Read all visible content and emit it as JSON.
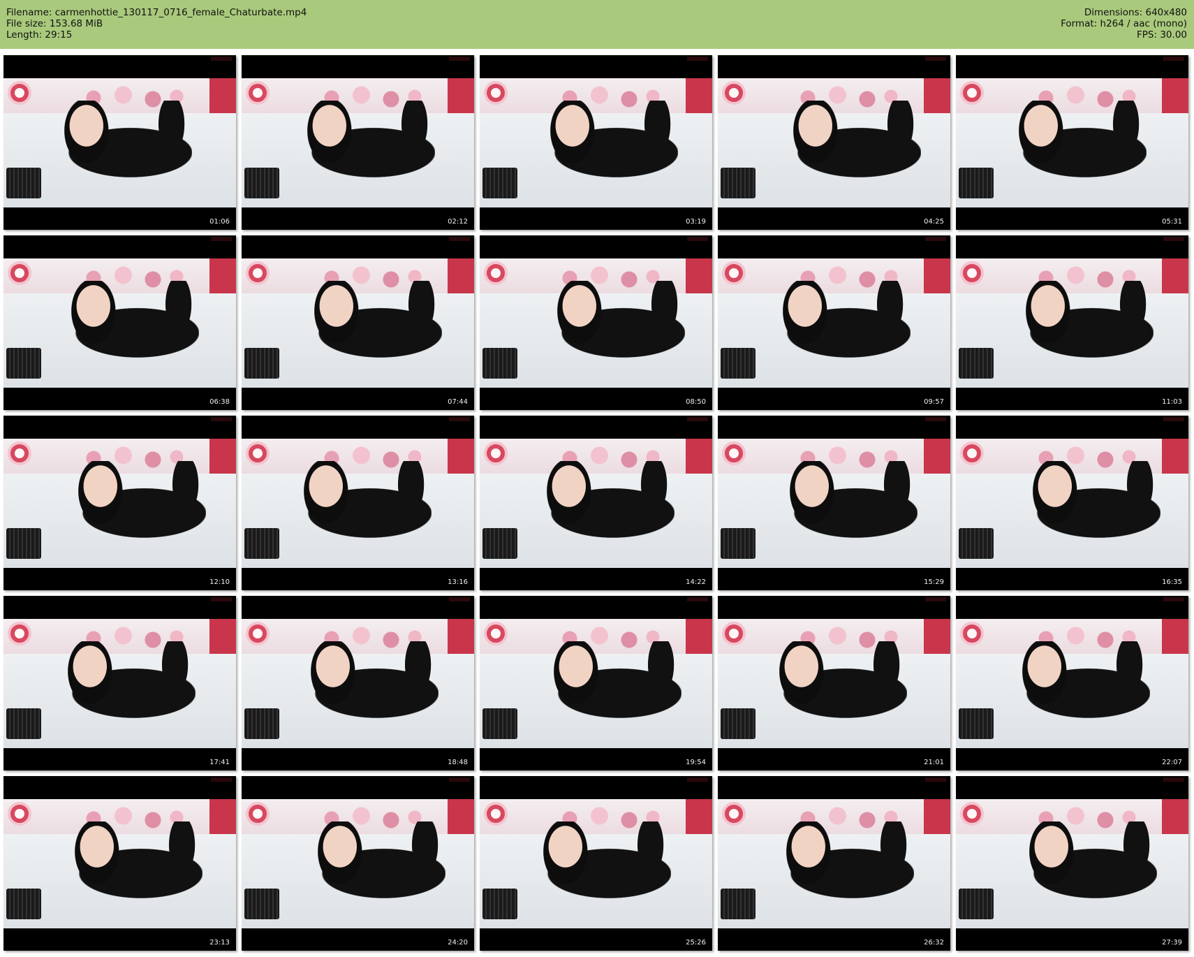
{
  "header": {
    "filename_line": "Filename: carmenhottie_130117_0716_female_Chaturbate.mp4",
    "filesize_line": "File size: 153.68 MiB",
    "length_line": "Length: 29:15",
    "dimensions_line": "Dimensions: 640x480",
    "format_line": "Format: h264 / aac (mono)",
    "fps_line": "FPS: 30.00",
    "background_color": "#a9c97c"
  },
  "thumbnails": [
    {
      "timestamp": "01:06"
    },
    {
      "timestamp": "02:12"
    },
    {
      "timestamp": "03:19"
    },
    {
      "timestamp": "04:25"
    },
    {
      "timestamp": "05:31"
    },
    {
      "timestamp": "06:38"
    },
    {
      "timestamp": "07:44"
    },
    {
      "timestamp": "08:50"
    },
    {
      "timestamp": "09:57"
    },
    {
      "timestamp": "11:03"
    },
    {
      "timestamp": "12:10"
    },
    {
      "timestamp": "13:16"
    },
    {
      "timestamp": "14:22"
    },
    {
      "timestamp": "15:29"
    },
    {
      "timestamp": "16:35"
    },
    {
      "timestamp": "17:41"
    },
    {
      "timestamp": "18:48"
    },
    {
      "timestamp": "19:54"
    },
    {
      "timestamp": "21:01"
    },
    {
      "timestamp": "22:07"
    },
    {
      "timestamp": "23:13"
    },
    {
      "timestamp": "24:20"
    },
    {
      "timestamp": "25:26"
    },
    {
      "timestamp": "26:32"
    },
    {
      "timestamp": "27:39"
    }
  ]
}
